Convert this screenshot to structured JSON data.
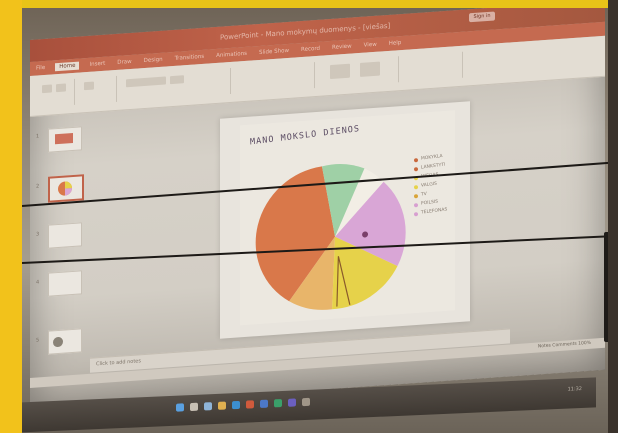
{
  "photo": {
    "subject": "projected-powerpoint-slide"
  },
  "app": {
    "title": "PowerPoint - Mano mokymų duomenys - [viešas]",
    "sign_in": "Sign in",
    "tabs": [
      "File",
      "Home",
      "Insert",
      "Draw",
      "Design",
      "Transitions",
      "Animations",
      "Slide Show",
      "Record",
      "Review",
      "View",
      "Help"
    ],
    "active_tab": "Home"
  },
  "slide": {
    "handwritten_title": "MANO MOKSLO DIENOS",
    "legend": [
      {
        "label": "MOKYKLA",
        "color": "#c9683c"
      },
      {
        "label": "LANKSTYTI",
        "color": "#c9683c"
      },
      {
        "label": "MIEGAS",
        "color": "#e6d24a"
      },
      {
        "label": "VALGIS",
        "color": "#e6d24a"
      },
      {
        "label": "TV",
        "color": "#d9a438"
      },
      {
        "label": "POILSIS",
        "color": "#d79fd0"
      },
      {
        "label": "TELEFONAS",
        "color": "#d79fd0"
      }
    ],
    "chart_colors": [
      "#d9784a",
      "#9fd0a6",
      "#d9a6d6",
      "#e6d24a",
      "#f2eee5"
    ]
  },
  "notes": {
    "placeholder": "Click to add notes"
  },
  "status": {
    "right": "Notes   Comments   100%"
  },
  "taskbar": {
    "time": "11:32"
  }
}
